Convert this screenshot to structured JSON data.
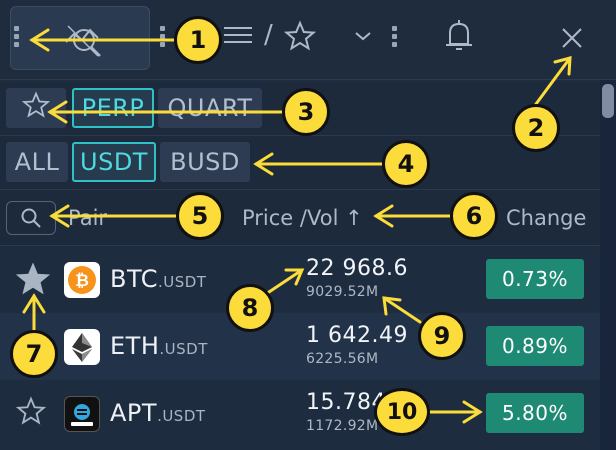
{
  "toolbar": {
    "separator": "/",
    "tools": [
      "grip-handle",
      "market-watch-icon",
      "list-icon",
      "favorites-star-icon",
      "chevron-down-icon",
      "bell-icon",
      "close-icon"
    ]
  },
  "contract_filters": {
    "favorites_icon": "star-outline-icon",
    "tabs": [
      {
        "label": "PERP",
        "active": true
      },
      {
        "label": "QUART",
        "active": false
      }
    ]
  },
  "quote_filters": {
    "tabs": [
      {
        "label": "ALL",
        "active": false
      },
      {
        "label": "USDT",
        "active": true
      },
      {
        "label": "BUSD",
        "active": false
      }
    ]
  },
  "table_header": {
    "search_icon": "search-icon",
    "pair_label": "Pair",
    "price_vol_label": "Price /Vol ↑",
    "change_label": "Change"
  },
  "rows": [
    {
      "base": "BTC",
      "quote": ".USDT",
      "price": "22 968.6",
      "volume": "9029.52M",
      "change": "0.73%",
      "favorite": true,
      "icon": "bitcoin-icon"
    },
    {
      "base": "ETH",
      "quote": ".USDT",
      "price": "1 642.49",
      "volume": "6225.56M",
      "change": "0.89%",
      "favorite": false,
      "icon": "ethereum-icon"
    },
    {
      "base": "APT",
      "quote": ".USDT",
      "price": "15.784",
      "volume": "1172.92M",
      "change": "5.80%",
      "favorite": false,
      "icon": "aptos-icon"
    }
  ],
  "annotations": [
    "1",
    "2",
    "3",
    "4",
    "5",
    "6",
    "7",
    "8",
    "9",
    "10"
  ],
  "colors": {
    "background": "#1e2c3f",
    "accent_cyan": "#2ec2c6",
    "positive_green": "#1f8a74",
    "callout_yellow": "#fbdc3a"
  }
}
